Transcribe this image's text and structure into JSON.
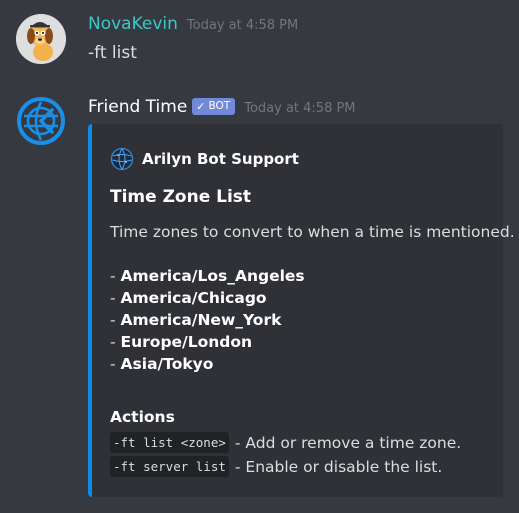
{
  "messages": [
    {
      "username": "NovaKevin",
      "username_color": "#1abc9c",
      "timestamp": "Today at 4:58 PM",
      "avatar": "dog-avatar",
      "content": "-ft list"
    },
    {
      "username": "Friend Time",
      "username_color": "#ffffff",
      "bot_tag": "BOT",
      "bot_check": "✓",
      "timestamp": "Today at 4:58 PM",
      "avatar": "globe-clock-icon",
      "embed": {
        "accent_color": "#0f8ce9",
        "author": "Arilyn Bot Support",
        "author_icon": "globe-icon",
        "title": "Time Zone List",
        "description": "Time zones to convert to when a time is mentioned.",
        "zone_prefix": "- ",
        "zones": [
          "America/Los_Angeles",
          "America/Chicago",
          "America/New_York",
          "Europe/London",
          "Asia/Tokyo"
        ],
        "field_name": "Actions",
        "actions": [
          {
            "command": "-ft list <zone>",
            "text": "- Add or remove a time zone."
          },
          {
            "command": "-ft server list",
            "text": "- Enable or disable the list."
          }
        ]
      }
    }
  ]
}
